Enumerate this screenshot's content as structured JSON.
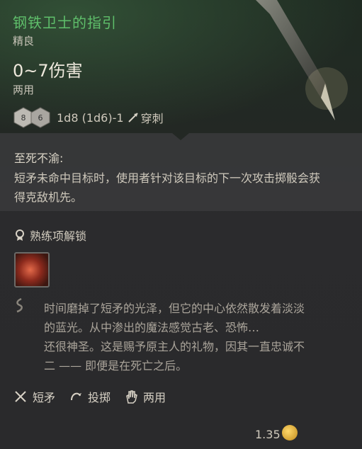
{
  "item": {
    "name": "钢铁卫士的指引",
    "rarity": "精良",
    "damage": "0~7伤害",
    "handedness": "两用",
    "dice": [
      "8",
      "6"
    ],
    "damage_formula": "1d8 (1d6)-1",
    "damage_type": "穿刺"
  },
  "passive": {
    "title": "至死不渝:",
    "description": "短矛未命中目标时，使用者针对该目标的下一次攻击掷骰会获得克敌机先。"
  },
  "proficiency": {
    "label": "熟练项解锁"
  },
  "flavor": {
    "lines": [
      "时间磨掉了短矛的光泽，但它的中心依然散发着淡淡",
      "的蓝光。从中渗出的魔法感觉古老、恐怖…",
      "还很神圣。这是赐予原主人的礼物，因其一直忠诚不",
      "二 —— 即便是在死亡之后。"
    ]
  },
  "tags": [
    {
      "icon": "spear-icon",
      "label": "短矛"
    },
    {
      "icon": "throw-icon",
      "label": "投掷"
    },
    {
      "icon": "hand-icon",
      "label": "两用"
    }
  ],
  "footer": {
    "value": "1.35"
  },
  "colors": {
    "title_green": "#5fbf6b",
    "panel_bg": "#2a2a2c"
  }
}
